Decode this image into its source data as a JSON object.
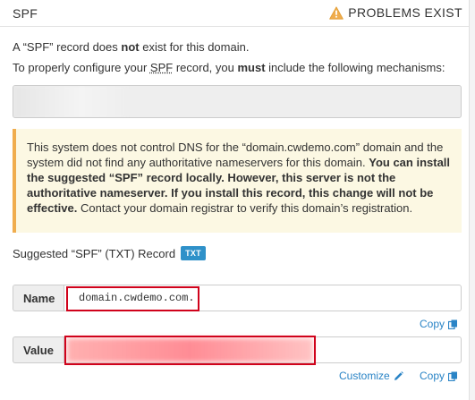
{
  "header": {
    "title": "SPF",
    "status": "PROBLEMS EXIST",
    "warning_icon": "warning-triangle-icon",
    "warning_color": "#f0ad4e"
  },
  "intro": {
    "line1_prefix": "A “SPF” record does ",
    "line1_bold": "not",
    "line1_suffix": " exist for this domain.",
    "line2_prefix": "To properly configure your ",
    "line2_abbr": "SPF",
    "line2_middle": " record, you ",
    "line2_bold": "must",
    "line2_suffix": " include the following mechanisms:"
  },
  "alert": {
    "text_plain": "This system does not control DNS for the “domain.cwdemo.com” domain and the system did not find any authoritative nameservers for this domain. ",
    "text_bold": "You can install the suggested “SPF” record locally. However, this server is not the authoritative nameserver. If you install this record, this change will not be effective.",
    "text_end": " Contact your domain registrar to verify this domain’s registration.",
    "background": "#fcf8e3",
    "border_color": "#f0ad4e"
  },
  "suggested": {
    "label": "Suggested “SPF” (TXT) Record",
    "badge": "TXT",
    "badge_color": "#2f91c9"
  },
  "fields": {
    "name_label": "Name",
    "name_value": "domain.cwdemo.com.",
    "value_label": "Value",
    "highlight_color": "#d0021b"
  },
  "links": {
    "copy": "Copy",
    "customize": "Customize",
    "copy_icon": "copy-icon",
    "edit_icon": "pencil-icon",
    "link_color": "#2a84c6"
  }
}
